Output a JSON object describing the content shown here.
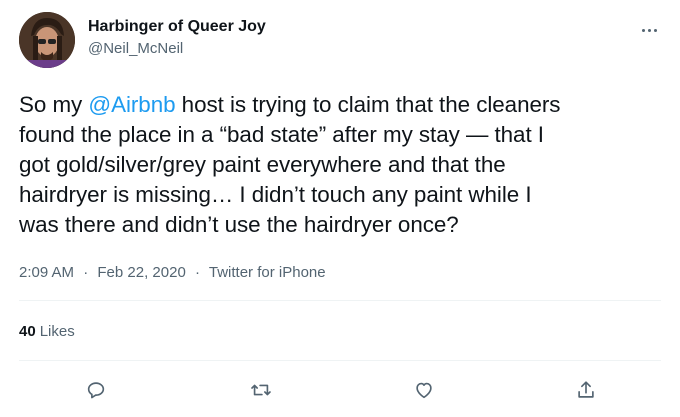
{
  "user": {
    "display_name": "Harbinger of Queer Joy",
    "handle": "@Neil_McNeil"
  },
  "tweet": {
    "lines": [
      {
        "pre": "So my ",
        "mention": "@Airbnb",
        "post": " host is trying to claim that the cleaners"
      },
      {
        "text": "found the place in a  “bad state” after my stay — that I"
      },
      {
        "text": "got gold/silver/grey paint everywhere and that the"
      },
      {
        "text": "hairdryer is missing… I didn’t touch any paint while I"
      },
      {
        "text": "was there and didn’t use the hairdryer once?"
      }
    ]
  },
  "meta": {
    "time": "2:09 AM",
    "separator": "·",
    "date": "Feb 22, 2020",
    "source": "Twitter for iPhone"
  },
  "stats": {
    "likes_count": "40",
    "likes_label": "Likes"
  },
  "icons": {
    "more": "more-options-icon",
    "reply": "reply-icon",
    "retweet": "retweet-icon",
    "like": "like-icon",
    "share": "share-icon"
  },
  "colors": {
    "text": "#0f1419",
    "secondary": "#536471",
    "mention": "#1d9bf0",
    "divider": "#eff3f4"
  }
}
